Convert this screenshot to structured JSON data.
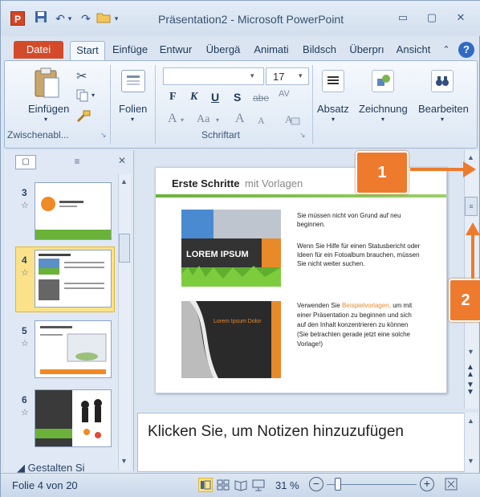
{
  "window": {
    "title": "Präsentation2 - Microsoft PowerPoint",
    "app_icon": "P",
    "controls": {
      "minimize": "▭",
      "maximize": "▢",
      "close": "✕"
    }
  },
  "quick_access": {
    "save_icon": "floppy-icon",
    "undo_glyph": "↶",
    "redo_glyph": "↷",
    "open_glyph": "📂",
    "menu_glyph": "▾"
  },
  "tabs": [
    "Datei",
    "Start",
    "Einfüge",
    "Entwur",
    "Übergä",
    "Animati",
    "Bildsch",
    "Überprı",
    "Ansicht"
  ],
  "ribbon": {
    "clipboard": {
      "paste_label": "Einfügen",
      "group_label": "Zwischenabl...",
      "launcher": "↘"
    },
    "slides": {
      "label": "Folien"
    },
    "font": {
      "font_name": "",
      "font_size": "17",
      "bold": "F",
      "italic": "K",
      "underline": "U",
      "shadow": "S",
      "strike": "abe",
      "spacing": "AV",
      "font_color": "A",
      "case": "Aa",
      "grow": "A",
      "shrink": "A",
      "clear": "A",
      "group_label": "Schriftart",
      "launcher": "↘"
    },
    "paragraph": {
      "label": "Absatz"
    },
    "drawing": {
      "label": "Zeichnung"
    },
    "editing": {
      "label": "Bearbeiten"
    }
  },
  "slides_pane": {
    "tabs": {
      "slides_glyph": "▢",
      "outline_glyph": "≡",
      "close_glyph": "✕"
    },
    "thumbs": [
      {
        "num": "3",
        "star": "☆"
      },
      {
        "num": "4",
        "star": "☆"
      },
      {
        "num": "5",
        "star": "☆"
      },
      {
        "num": "6",
        "star": "☆"
      }
    ],
    "section_label": "Gestalten Si",
    "section_arrow": "◢"
  },
  "slide": {
    "title_bold": "Erste Schritte",
    "title_rest": " mit Vorlagen",
    "image1_text": "LOREM IPSUM",
    "image2_text": "Lorem Ipsum Dolor",
    "para1": "Sie müssen nicht von Grund auf neu beginnen.",
    "para2": "Wenn Sie Hilfe für einen Statusbericht oder Ideen für ein Fotoalbum brauchen, müssen Sie nicht weiter suchen.",
    "para3_pre": "Verwenden Sie ",
    "para3_link": "Beispielvorlagen,",
    "para3_post": " um mit einer Präsentation zu beginnen und sich auf den Inhalt konzentrieren zu können (Sie betrachten gerade jetzt eine solche Vorlage!)"
  },
  "notes": {
    "placeholder": "Klicken Sie, um Notizen hinzuzufügen"
  },
  "status": {
    "slide_info": "Folie 4 von 20",
    "zoom": "31 %",
    "zoom_minus": "−",
    "zoom_plus": "+"
  },
  "callouts": {
    "one": "1",
    "two": "2"
  },
  "colors": {
    "accent_orange": "#ee7a2e",
    "file_tab": "#d34b2a",
    "selected_thumb": "#fbe28a"
  }
}
